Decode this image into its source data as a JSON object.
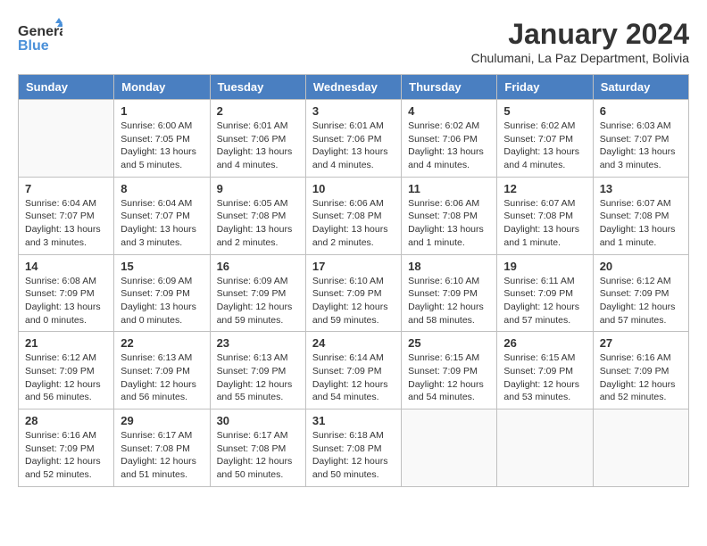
{
  "header": {
    "logo_line1": "General",
    "logo_line2": "Blue",
    "month_title": "January 2024",
    "location": "Chulumani, La Paz Department, Bolivia"
  },
  "weekdays": [
    "Sunday",
    "Monday",
    "Tuesday",
    "Wednesday",
    "Thursday",
    "Friday",
    "Saturday"
  ],
  "weeks": [
    [
      {
        "day": "",
        "empty": true
      },
      {
        "day": "1",
        "sunrise": "6:00 AM",
        "sunset": "7:05 PM",
        "daylight": "13 hours and 5 minutes."
      },
      {
        "day": "2",
        "sunrise": "6:01 AM",
        "sunset": "7:06 PM",
        "daylight": "13 hours and 4 minutes."
      },
      {
        "day": "3",
        "sunrise": "6:01 AM",
        "sunset": "7:06 PM",
        "daylight": "13 hours and 4 minutes."
      },
      {
        "day": "4",
        "sunrise": "6:02 AM",
        "sunset": "7:06 PM",
        "daylight": "13 hours and 4 minutes."
      },
      {
        "day": "5",
        "sunrise": "6:02 AM",
        "sunset": "7:07 PM",
        "daylight": "13 hours and 4 minutes."
      },
      {
        "day": "6",
        "sunrise": "6:03 AM",
        "sunset": "7:07 PM",
        "daylight": "13 hours and 3 minutes."
      }
    ],
    [
      {
        "day": "7",
        "sunrise": "6:04 AM",
        "sunset": "7:07 PM",
        "daylight": "13 hours and 3 minutes."
      },
      {
        "day": "8",
        "sunrise": "6:04 AM",
        "sunset": "7:07 PM",
        "daylight": "13 hours and 3 minutes."
      },
      {
        "day": "9",
        "sunrise": "6:05 AM",
        "sunset": "7:08 PM",
        "daylight": "13 hours and 2 minutes."
      },
      {
        "day": "10",
        "sunrise": "6:06 AM",
        "sunset": "7:08 PM",
        "daylight": "13 hours and 2 minutes."
      },
      {
        "day": "11",
        "sunrise": "6:06 AM",
        "sunset": "7:08 PM",
        "daylight": "13 hours and 1 minute."
      },
      {
        "day": "12",
        "sunrise": "6:07 AM",
        "sunset": "7:08 PM",
        "daylight": "13 hours and 1 minute."
      },
      {
        "day": "13",
        "sunrise": "6:07 AM",
        "sunset": "7:08 PM",
        "daylight": "13 hours and 1 minute."
      }
    ],
    [
      {
        "day": "14",
        "sunrise": "6:08 AM",
        "sunset": "7:09 PM",
        "daylight": "13 hours and 0 minutes."
      },
      {
        "day": "15",
        "sunrise": "6:09 AM",
        "sunset": "7:09 PM",
        "daylight": "13 hours and 0 minutes."
      },
      {
        "day": "16",
        "sunrise": "6:09 AM",
        "sunset": "7:09 PM",
        "daylight": "12 hours and 59 minutes."
      },
      {
        "day": "17",
        "sunrise": "6:10 AM",
        "sunset": "7:09 PM",
        "daylight": "12 hours and 59 minutes."
      },
      {
        "day": "18",
        "sunrise": "6:10 AM",
        "sunset": "7:09 PM",
        "daylight": "12 hours and 58 minutes."
      },
      {
        "day": "19",
        "sunrise": "6:11 AM",
        "sunset": "7:09 PM",
        "daylight": "12 hours and 57 minutes."
      },
      {
        "day": "20",
        "sunrise": "6:12 AM",
        "sunset": "7:09 PM",
        "daylight": "12 hours and 57 minutes."
      }
    ],
    [
      {
        "day": "21",
        "sunrise": "6:12 AM",
        "sunset": "7:09 PM",
        "daylight": "12 hours and 56 minutes."
      },
      {
        "day": "22",
        "sunrise": "6:13 AM",
        "sunset": "7:09 PM",
        "daylight": "12 hours and 56 minutes."
      },
      {
        "day": "23",
        "sunrise": "6:13 AM",
        "sunset": "7:09 PM",
        "daylight": "12 hours and 55 minutes."
      },
      {
        "day": "24",
        "sunrise": "6:14 AM",
        "sunset": "7:09 PM",
        "daylight": "12 hours and 54 minutes."
      },
      {
        "day": "25",
        "sunrise": "6:15 AM",
        "sunset": "7:09 PM",
        "daylight": "12 hours and 54 minutes."
      },
      {
        "day": "26",
        "sunrise": "6:15 AM",
        "sunset": "7:09 PM",
        "daylight": "12 hours and 53 minutes."
      },
      {
        "day": "27",
        "sunrise": "6:16 AM",
        "sunset": "7:09 PM",
        "daylight": "12 hours and 52 minutes."
      }
    ],
    [
      {
        "day": "28",
        "sunrise": "6:16 AM",
        "sunset": "7:09 PM",
        "daylight": "12 hours and 52 minutes."
      },
      {
        "day": "29",
        "sunrise": "6:17 AM",
        "sunset": "7:08 PM",
        "daylight": "12 hours and 51 minutes."
      },
      {
        "day": "30",
        "sunrise": "6:17 AM",
        "sunset": "7:08 PM",
        "daylight": "12 hours and 50 minutes."
      },
      {
        "day": "31",
        "sunrise": "6:18 AM",
        "sunset": "7:08 PM",
        "daylight": "12 hours and 50 minutes."
      },
      {
        "day": "",
        "empty": true
      },
      {
        "day": "",
        "empty": true
      },
      {
        "day": "",
        "empty": true
      }
    ]
  ]
}
